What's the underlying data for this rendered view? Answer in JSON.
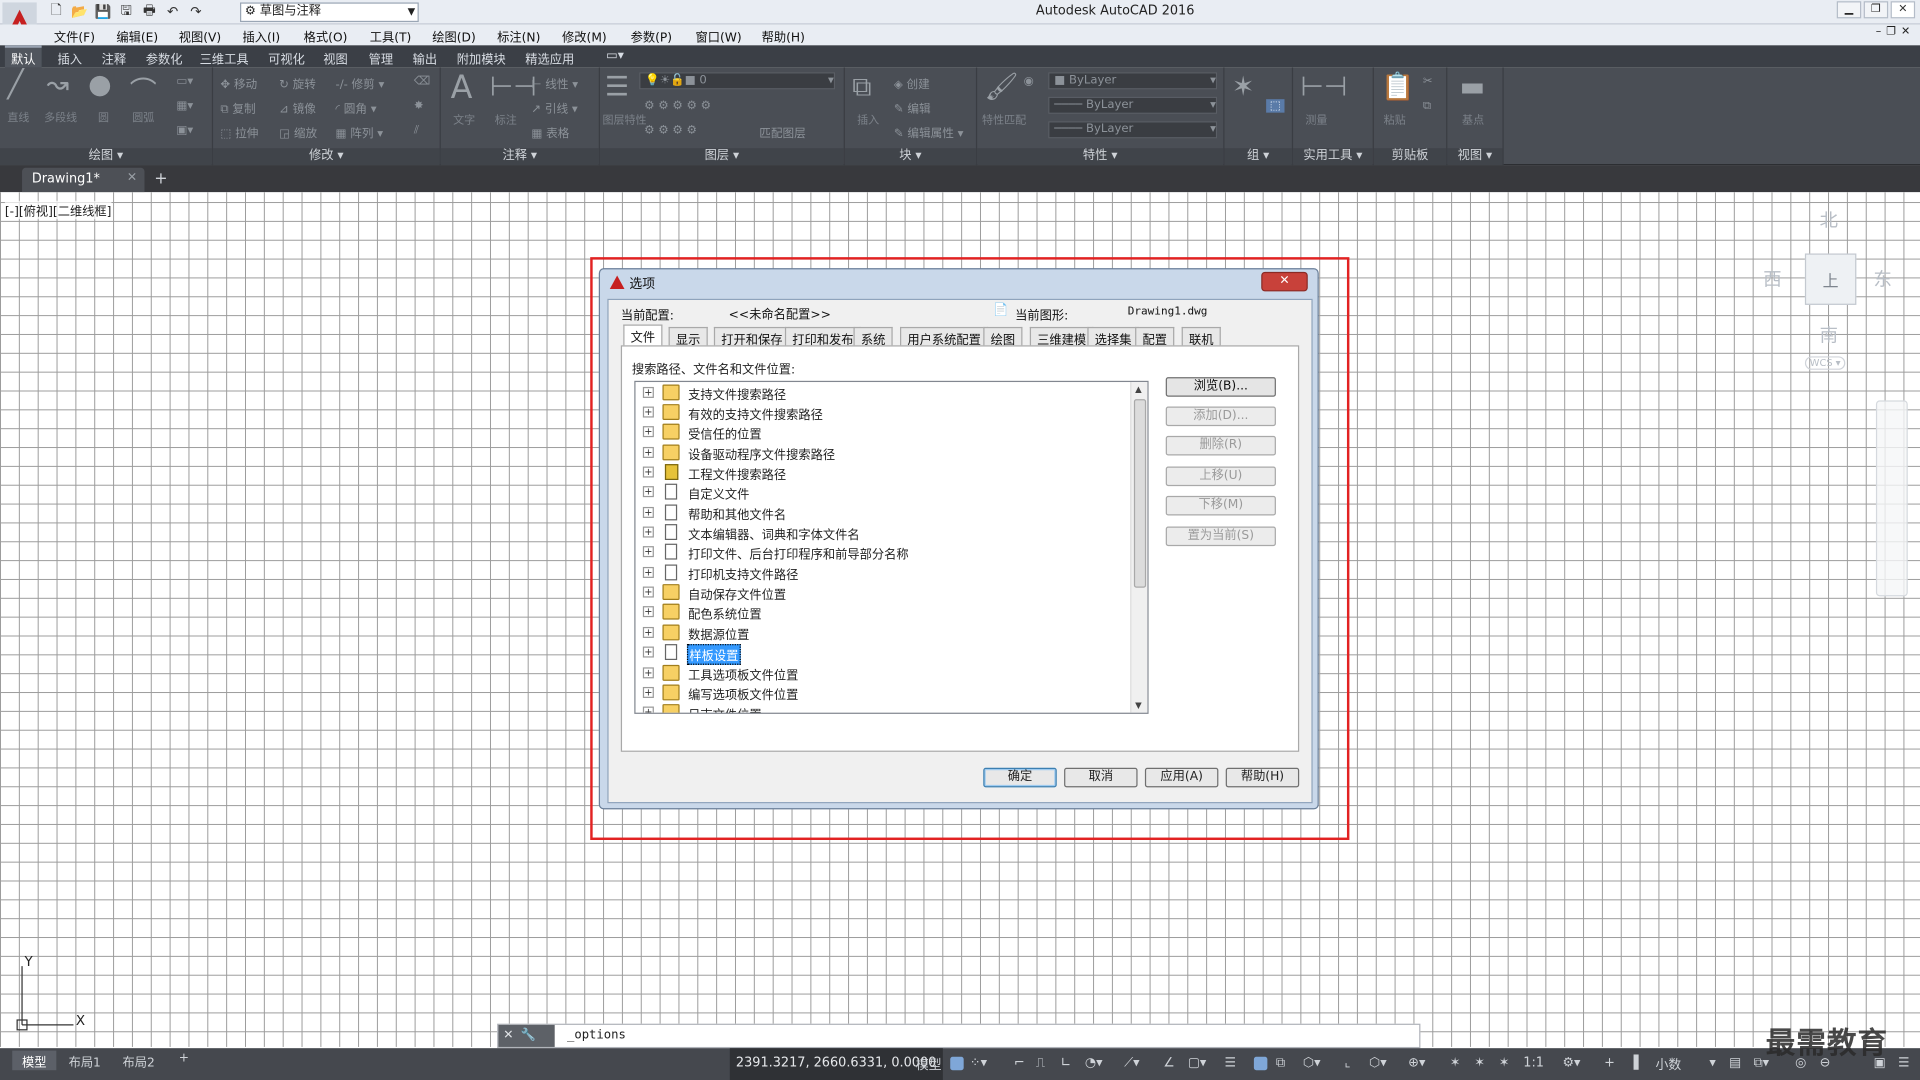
{
  "app": {
    "title": "Autodesk AutoCAD 2016",
    "workspace": "草图与注释",
    "menus": [
      "文件(F)",
      "编辑(E)",
      "视图(V)",
      "插入(I)",
      "格式(O)",
      "工具(T)",
      "绘图(D)",
      "标注(N)",
      "修改(M)",
      "参数(P)",
      "窗口(W)",
      "帮助(H)"
    ],
    "ribbon_tabs": [
      "默认",
      "插入",
      "注释",
      "参数化",
      "三维工具",
      "可视化",
      "视图",
      "管理",
      "输出",
      "附加模块",
      "精选应用"
    ],
    "active_ribbon_tab": "默认"
  },
  "ribbon": {
    "panels": [
      "绘图",
      "修改",
      "注释",
      "图层",
      "块",
      "特性",
      "组",
      "实用工具",
      "剪贴板",
      "视图"
    ],
    "draw": {
      "line": "直线",
      "polyline": "多段线",
      "circle": "圆",
      "arc": "圆弧"
    },
    "modify": {
      "move": "移动",
      "rotate": "旋转",
      "trim": "修剪",
      "copy": "复制",
      "mirror": "镜像",
      "fillet": "圆角",
      "stretch": "拉伸",
      "scale": "缩放",
      "array": "阵列"
    },
    "annotation": {
      "text": "文字",
      "dimension": "标注",
      "linear": "线性",
      "leader": "引线",
      "table": "表格"
    },
    "layers": {
      "properties": "图层特性",
      "current_layer": "0",
      "match": "匹配图层"
    },
    "block": {
      "insert": "插入",
      "create": "创建",
      "edit": "编辑",
      "edit_attr": "编辑属性"
    },
    "properties": {
      "match": "特性匹配",
      "color": "ByLayer",
      "linetype": "ByLayer",
      "lineweight": "ByLayer"
    },
    "utilities": {
      "measure": "测量"
    },
    "clipboard": {
      "paste": "粘贴"
    },
    "view": {
      "base": "基点"
    }
  },
  "document": {
    "tab": "Drawing1*",
    "viewport_label": "[-][俯视][二维线框]"
  },
  "viewcube": {
    "north": "北",
    "south": "南",
    "east": "东",
    "west": "西",
    "top": "上",
    "wcs": "WCS"
  },
  "ucs": {
    "x": "X",
    "y": "Y"
  },
  "dialog": {
    "title": "选项",
    "current_profile_label": "当前配置:",
    "current_profile_value": "<<未命名配置>>",
    "current_drawing_label": "当前图形:",
    "current_drawing_value": "Drawing1.dwg",
    "tabs": [
      "文件",
      "显示",
      "打开和保存",
      "打印和发布",
      "系统",
      "用户系统配置",
      "绘图",
      "三维建模",
      "选择集",
      "配置",
      "联机"
    ],
    "active_tab": "文件",
    "section_label": "搜索路径、文件名和文件位置:",
    "tree_items": [
      {
        "label": "支持文件搜索路径",
        "icon": "folder"
      },
      {
        "label": "有效的支持文件搜索路径",
        "icon": "folder"
      },
      {
        "label": "受信任的位置",
        "icon": "folder"
      },
      {
        "label": "设备驱动程序文件搜索路径",
        "icon": "folder"
      },
      {
        "label": "工程文件搜索路径",
        "icon": "project"
      },
      {
        "label": "自定义文件",
        "icon": "doc"
      },
      {
        "label": "帮助和其他文件名",
        "icon": "doc"
      },
      {
        "label": "文本编辑器、词典和字体文件名",
        "icon": "doc"
      },
      {
        "label": "打印文件、后台打印程序和前导部分名称",
        "icon": "doc"
      },
      {
        "label": "打印机支持文件路径",
        "icon": "doc"
      },
      {
        "label": "自动保存文件位置",
        "icon": "folder"
      },
      {
        "label": "配色系统位置",
        "icon": "folder"
      },
      {
        "label": "数据源位置",
        "icon": "folder"
      },
      {
        "label": "样板设置",
        "icon": "doc",
        "selected": true
      },
      {
        "label": "工具选项板文件位置",
        "icon": "folder"
      },
      {
        "label": "编写选项板文件位置",
        "icon": "folder"
      },
      {
        "label": "日志文件位置",
        "icon": "folder"
      }
    ],
    "side_buttons": [
      {
        "label": "浏览(B)...",
        "enabled": true
      },
      {
        "label": "添加(D)...",
        "enabled": false
      },
      {
        "label": "删除(R)",
        "enabled": false
      },
      {
        "label": "上移(U)",
        "enabled": false
      },
      {
        "label": "下移(M)",
        "enabled": false
      },
      {
        "label": "置为当前(S)",
        "enabled": false
      }
    ],
    "ok": "确定",
    "cancel": "取消",
    "apply": "应用(A)",
    "help": "帮助(H)"
  },
  "command_line": {
    "text": "_options"
  },
  "status": {
    "layout_tabs": [
      "模型",
      "布局1",
      "布局2"
    ],
    "coords": "2391.3217, 2660.6331, 0.0000",
    "model": "模型",
    "scale": "1:1",
    "units": "小数"
  },
  "watermark": "最需教育",
  "colors": {
    "highlight": "#e22222",
    "selection": "#3399ff",
    "ribbon_bg": "#4a4e55"
  }
}
